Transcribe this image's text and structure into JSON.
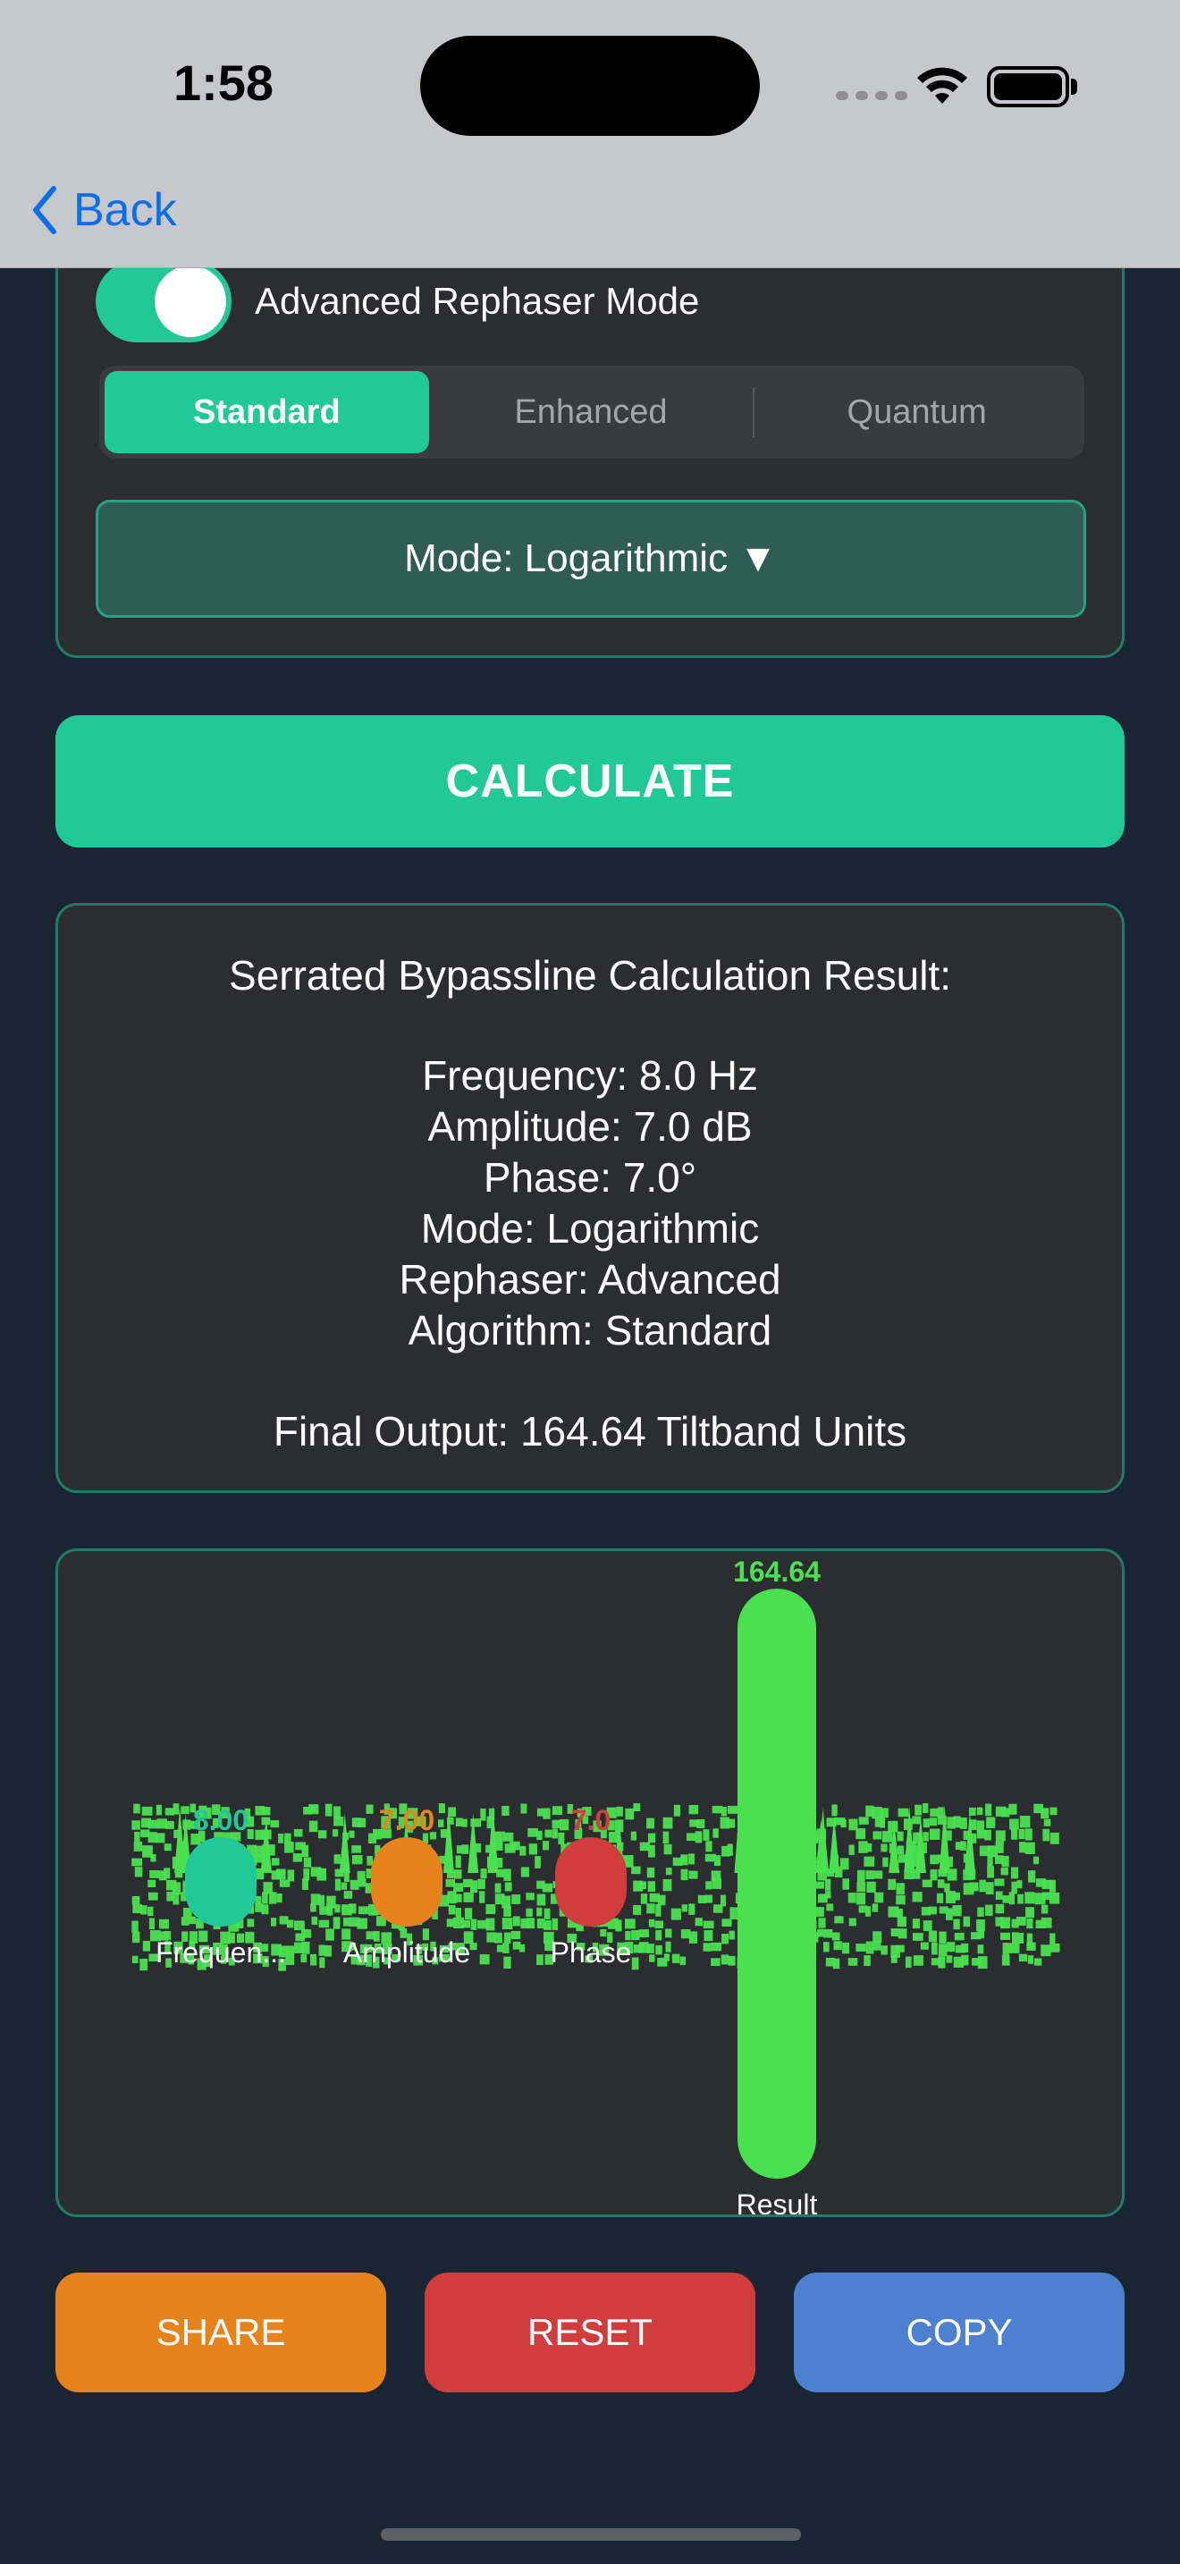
{
  "status_bar": {
    "time": "1:58",
    "icons": [
      "signal-dots-icon",
      "wifi-icon",
      "battery-icon"
    ]
  },
  "nav": {
    "back_label": "Back"
  },
  "settings": {
    "toggle_label": "Advanced Rephaser Mode",
    "toggle_on": true,
    "algorithms": [
      "Standard",
      "Enhanced",
      "Quantum"
    ],
    "selected_algorithm": "Standard",
    "mode_label": "Mode: Logarithmic ▼"
  },
  "calculate_label": "CALCULATE",
  "result": {
    "title": "Serrated Bypassline Calculation Result:",
    "lines": [
      "Frequency: 8.0 Hz",
      "Amplitude: 7.0 dB",
      "Phase: 7.0°",
      "Mode: Logarithmic",
      "Rephaser: Advanced",
      "Algorithm: Standard"
    ],
    "final_output": "Final Output: 164.64 Tiltband Units"
  },
  "chart_data": {
    "type": "bar",
    "categories": [
      "Frequen...",
      "Amplitude",
      "Phase",
      "Result"
    ],
    "values": [
      8.0,
      7.0,
      7.0,
      164.64
    ],
    "value_labels": [
      "8.00",
      "7.00",
      "7.0",
      "164.64"
    ],
    "colors": [
      "#20c997",
      "#e8821a",
      "#d13c3c",
      "#4ae150"
    ],
    "ylim": [
      0,
      164.64
    ]
  },
  "actions": {
    "share": "SHARE",
    "reset": "RESET",
    "copy": "COPY"
  },
  "colors": {
    "accent": "#20c997",
    "background": "#1a2533",
    "card": "#2c2d30",
    "result_bar": "#4ae150"
  }
}
